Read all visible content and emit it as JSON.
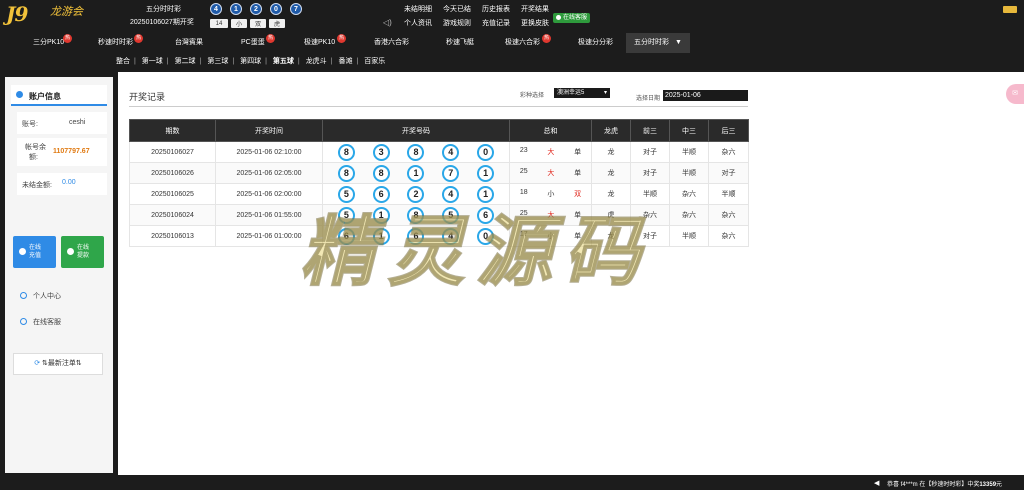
{
  "header": {
    "logo": "J9",
    "logo_sub": "龙游会",
    "lottery_name": "五分时时彩",
    "period_text": "20250106027期开奖",
    "balls": [
      "4",
      "1",
      "2",
      "0",
      "7"
    ],
    "tags": [
      "14",
      "小",
      "双",
      "虎"
    ],
    "links": [
      "未结明细",
      "今天已结",
      "历史报表",
      "开奖结果",
      "个人资讯",
      "游戏规则",
      "充值记录",
      "更换皮肤"
    ],
    "online_service": "在线客服"
  },
  "game_nav": {
    "tabs": [
      {
        "label": "三分PK10",
        "hot": "热"
      },
      {
        "label": "秒速时时彩",
        "hot": "热"
      },
      {
        "label": "台灣賓果",
        "hot": ""
      },
      {
        "label": "PC蛋蛋",
        "hot": "热"
      },
      {
        "label": "极速PK10",
        "hot": "热"
      },
      {
        "label": "香港六合彩",
        "hot": ""
      },
      {
        "label": "秒速飞艇",
        "hot": ""
      },
      {
        "label": "极速六合彩",
        "hot": "热"
      },
      {
        "label": "极速分分彩",
        "hot": ""
      },
      {
        "label": "五分时时彩",
        "hot": ""
      }
    ]
  },
  "sub_nav": {
    "items": [
      "整合",
      "第一球",
      "第二球",
      "第三球",
      "第四球",
      "第五球",
      "龙虎斗",
      "番滩",
      "百家乐"
    ],
    "active": "第五球"
  },
  "sidebar": {
    "title": "账户信息",
    "account_label": "账号:",
    "account_value": "ceshi",
    "balance_label_1": "帐号余",
    "balance_label_2": "额:",
    "balance_value": "1107797.67",
    "unsettled_label": "未结金额:",
    "unsettled_value": "0.00",
    "recharge_1": "在线",
    "recharge_2": "充值",
    "withdraw_1": "在线",
    "withdraw_2": "提款",
    "personal_center": "个人中心",
    "customer_service": "在线客服",
    "refresh": "⇅最新注单⇅"
  },
  "main": {
    "title": "开奖记录",
    "lottery_select_label": "彩种选择",
    "lottery_select_value": "澳洲幸运5",
    "date_label": "选择日期",
    "date_value": "2025-01-06",
    "columns": [
      "期数",
      "开奖时间",
      "开奖号码",
      "总和",
      "龙虎",
      "前三",
      "中三",
      "后三"
    ],
    "rows": [
      {
        "period": "20250106027",
        "time": "2025-01-06 02:10:00",
        "balls": [
          "8",
          "3",
          "8",
          "4",
          "0"
        ],
        "sum": "23",
        "size": "大",
        "oe": "单",
        "dt": "龙",
        "front": "对子",
        "mid": "半顺",
        "back": "杂六"
      },
      {
        "period": "20250106026",
        "time": "2025-01-06 02:05:00",
        "balls": [
          "8",
          "8",
          "1",
          "7",
          "1"
        ],
        "sum": "25",
        "size": "大",
        "oe": "单",
        "dt": "龙",
        "front": "对子",
        "mid": "半顺",
        "back": "对子"
      },
      {
        "period": "20250106025",
        "time": "2025-01-06 02:00:00",
        "balls": [
          "5",
          "6",
          "2",
          "4",
          "1"
        ],
        "sum": "18",
        "size": "小",
        "oe": "双",
        "dt": "龙",
        "front": "半顺",
        "mid": "杂六",
        "back": "半顺"
      },
      {
        "period": "20250106024",
        "time": "2025-01-06 01:55:00",
        "balls": [
          "5",
          "1",
          "8",
          "5",
          "6"
        ],
        "sum": "25",
        "size": "大",
        "oe": "单",
        "dt": "虎",
        "front": "杂六",
        "mid": "杂六",
        "back": "杂六"
      },
      {
        "period": "20250106013",
        "time": "2025-01-06 01:00:00",
        "balls": [
          "6",
          "1",
          "6",
          "4",
          "0"
        ],
        "sum": "17",
        "size": "小",
        "oe": "单",
        "dt": "龙",
        "front": "对子",
        "mid": "半顺",
        "back": "杂六"
      }
    ],
    "watermark": "精灵源码"
  },
  "ticker": {
    "text": "恭喜 f4***m 在【秒速时时彩】中奖",
    "amount": "13359",
    "unit": "元"
  },
  "colors": {
    "accent_blue": "#2f8be6",
    "gold": "#f2c23a",
    "red": "#e0261c",
    "green": "#2e9a3c",
    "ball_ring": "#2aa7e8"
  }
}
